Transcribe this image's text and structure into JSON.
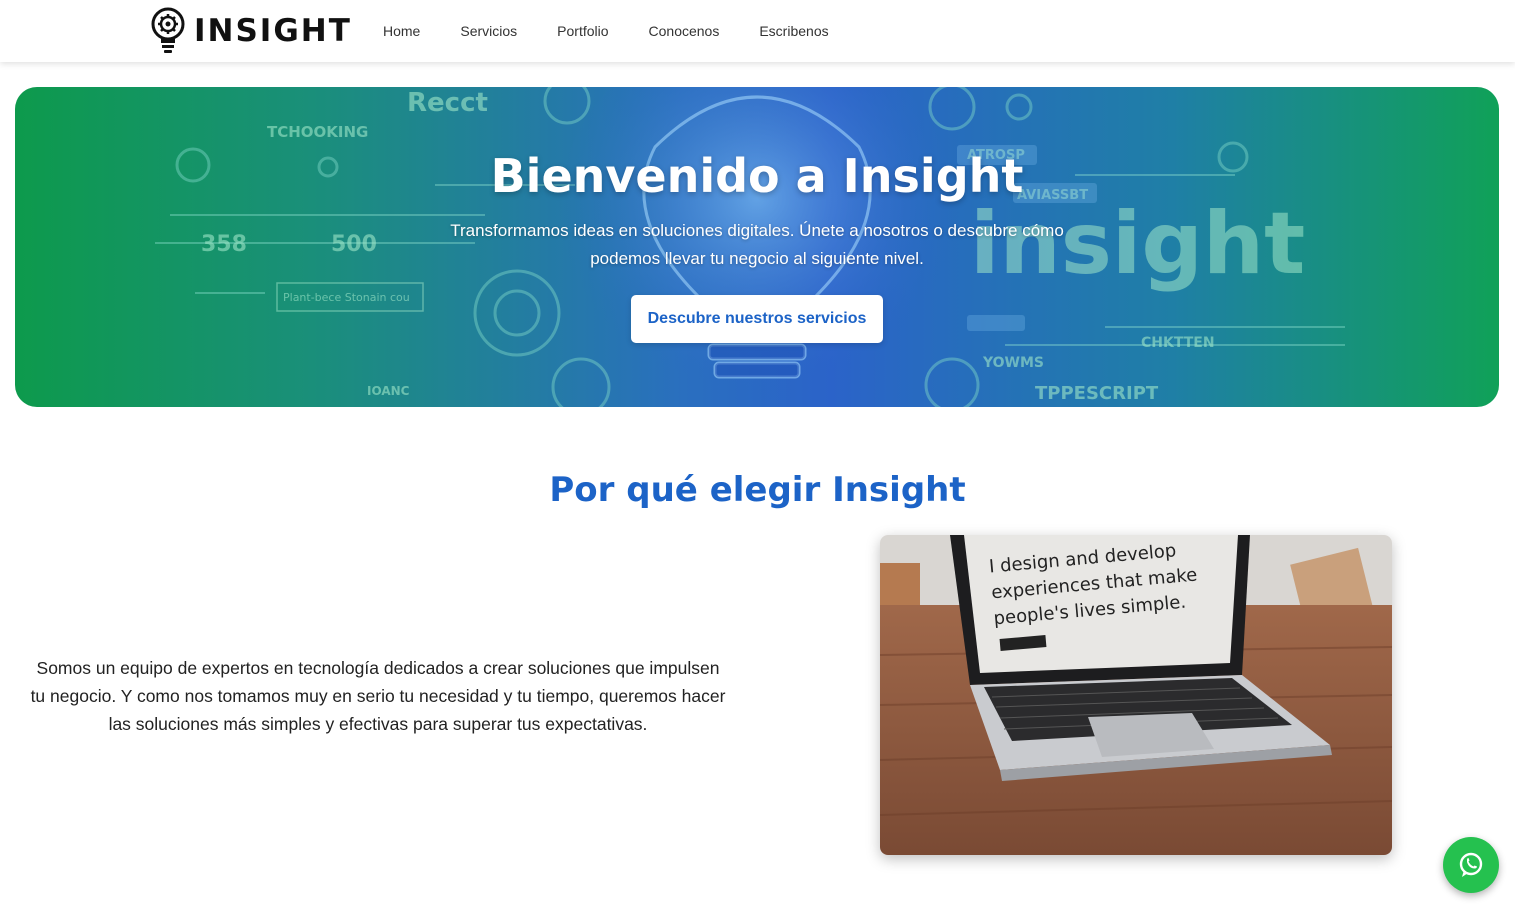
{
  "brand": {
    "name": "INSIGHT"
  },
  "nav": {
    "items": [
      {
        "label": "Home"
      },
      {
        "label": "Servicios"
      },
      {
        "label": "Portfolio"
      },
      {
        "label": "Conocenos"
      },
      {
        "label": "Escribenos"
      }
    ]
  },
  "hero": {
    "title": "Bienvenido a Insight",
    "subtitle": "Transformamos ideas en soluciones digitales. Únete a nosotros o descubre cómo podemos llevar tu negocio al siguiente nivel.",
    "cta_label": "Descubre nuestros servicios",
    "art_words": [
      "Recct",
      "TCHOOKING",
      "insight",
      "TPPESCRIPT",
      "CHKTTEN",
      "358",
      "500",
      "ATROSP",
      "AVIASSBT",
      "YOWMS",
      "IOANC",
      "Plant-bece Stonain cou"
    ]
  },
  "why": {
    "title": "Por qué elegir Insight",
    "text": "Somos un equipo de expertos en tecnología dedicados a crear soluciones que impulsen tu negocio. Y como nos tomamos muy en serio tu necesidad y tu tiempo, queremos hacer las soluciones más simples y efectivas para superar tus expectativas."
  },
  "photo": {
    "screen_text_1": "I design and develop",
    "screen_text_2": "experiences that make",
    "screen_text_3": "people's lives simple."
  },
  "colors": {
    "accent": "#1c63c7",
    "hero_green": "#0d9a4c",
    "hero_blue": "#2b63c9",
    "whatsapp": "#25c14f"
  },
  "icons": {
    "logo": "lightbulb-gear-icon",
    "fab": "whatsapp-icon"
  }
}
